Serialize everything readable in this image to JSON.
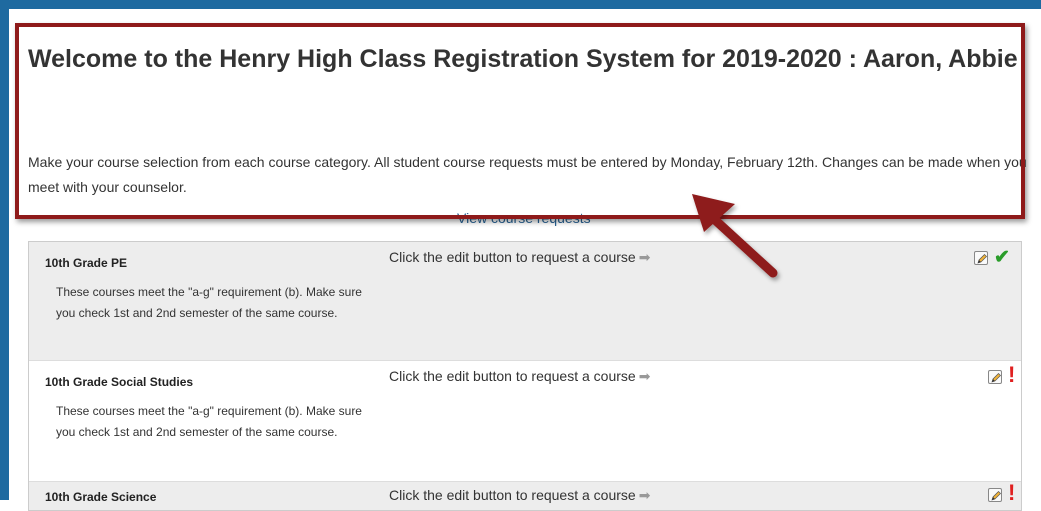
{
  "page": {
    "title": "Welcome to the Henry High Class Registration System for 2019-2020 : Aaron, Abbie",
    "intro": "Make your course selection from each course category. All student course requests must be entered by Monday, February 12th. Changes can be made when you meet with your counselor.",
    "view_link": "View course requests"
  },
  "colors": {
    "frame": "#1e6aa0",
    "highlight_border": "#8e1a1a",
    "check": "#2a9d2a",
    "alert": "#e02020"
  },
  "categories": [
    {
      "name": "10th Grade PE",
      "description": "These courses meet the \"a-g\" requirement (b). Make sure you check 1st and 2nd semester of the same course.",
      "prompt": "Click the edit button to request a course",
      "prompt_icon": "arrow-right-icon",
      "edit_icon": "pencil-edit-icon",
      "status_icon": "checkmark-icon",
      "status_symbol": "✔"
    },
    {
      "name": "10th Grade Social Studies",
      "description": "These courses meet the \"a-g\" requirement (b). Make sure you check 1st and 2nd semester of the same course.",
      "prompt": "Click the edit button to request a course",
      "prompt_icon": "arrow-right-icon",
      "edit_icon": "pencil-edit-icon",
      "status_icon": "exclamation-icon",
      "status_symbol": "!"
    },
    {
      "name": "10th Grade Science",
      "description": "",
      "prompt": "Click the edit button to request a course",
      "prompt_icon": "arrow-right-icon",
      "edit_icon": "pencil-edit-icon",
      "status_icon": "exclamation-icon",
      "status_symbol": "!"
    }
  ]
}
